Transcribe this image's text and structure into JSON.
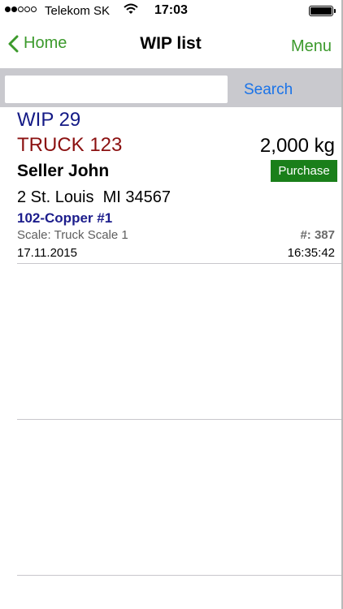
{
  "status_bar": {
    "carrier": "Telekom SK",
    "time": "17:03"
  },
  "nav": {
    "back_label": "Home",
    "title": "WIP list",
    "menu_label": "Menu"
  },
  "search": {
    "value": "",
    "button_label": "Search"
  },
  "items": [
    {
      "wip": "WIP 29",
      "vehicle": "TRUCK 123",
      "weight": "2,000 kg",
      "seller": "Seller John",
      "type": "Purchase",
      "address": "2 St. Louis  MI 34567",
      "material": "102-Copper #1",
      "scale": "Scale: Truck Scale 1",
      "number": "#: 387",
      "date": "17.11.2015",
      "time": "16:35:42"
    }
  ],
  "colors": {
    "accent": "#3c9a2c",
    "search_button": "#1a73e8",
    "wip_title": "#141a86",
    "vehicle": "#8b1111",
    "badge": "#1a7f1a",
    "material": "#1c1d8c"
  }
}
